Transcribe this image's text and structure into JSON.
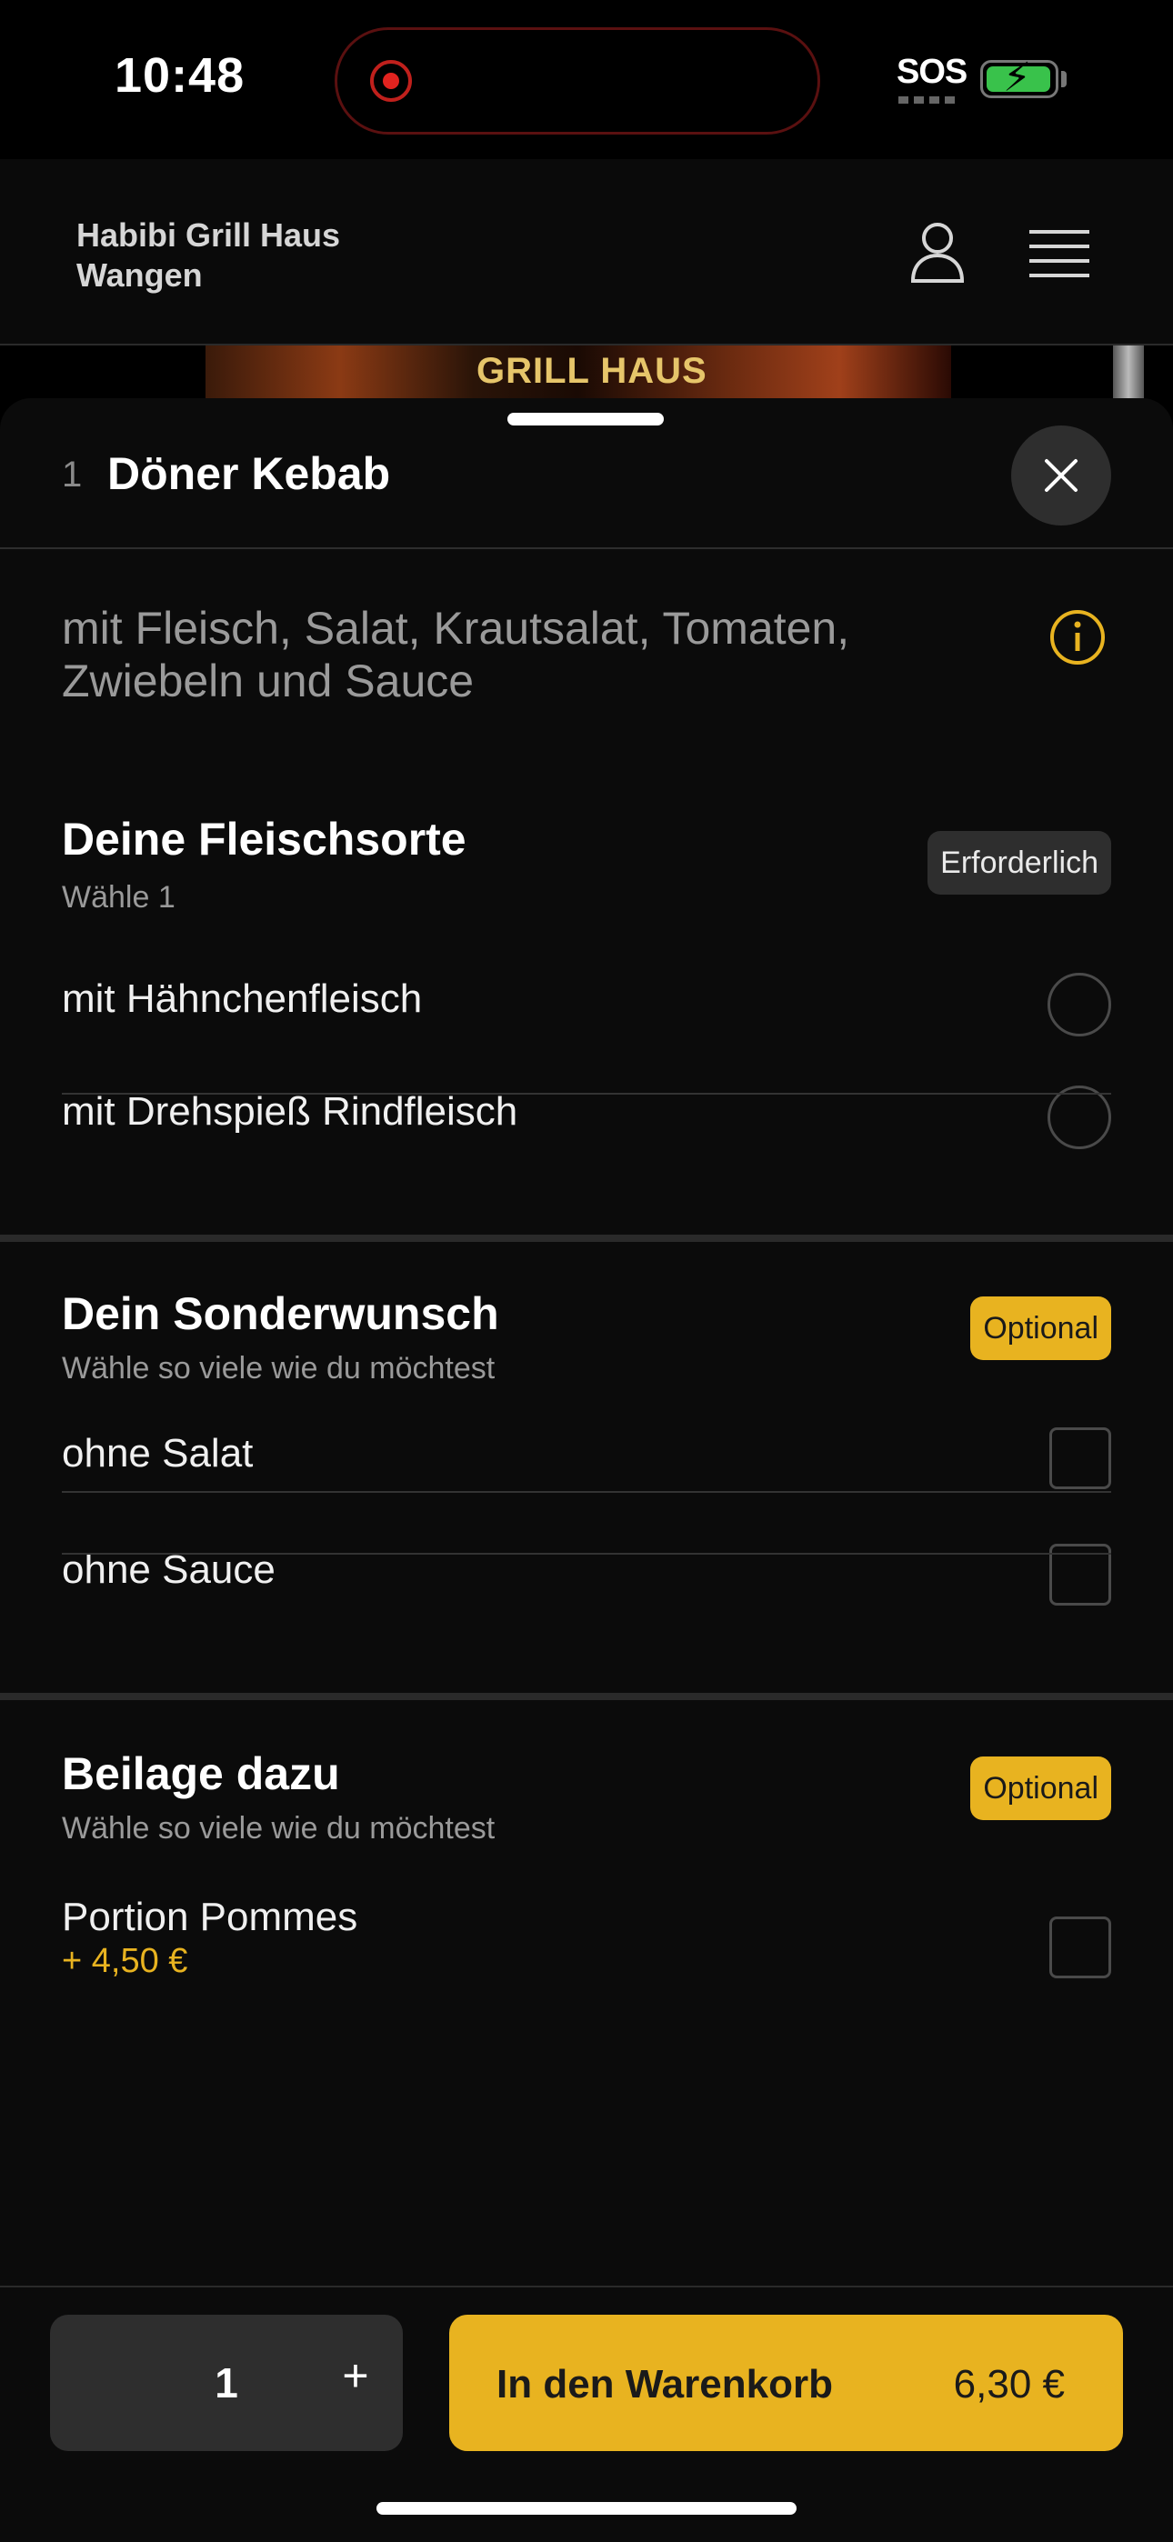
{
  "status_bar": {
    "time": "10:48",
    "sos": "SOS"
  },
  "header": {
    "store_name_line1": "Habibi Grill Haus",
    "store_name_line2": "Wangen"
  },
  "banner": {
    "text": "GRILL HAUS"
  },
  "product": {
    "quantity_prefix": "1",
    "title": "Döner Kebab",
    "description": "mit Fleisch, Salat, Krautsalat, Tomaten, Zwiebeln und Sauce"
  },
  "sections": {
    "meat": {
      "title": "Deine Fleischsorte",
      "subtitle": "Wähle 1",
      "badge": "Erforderlich",
      "options": [
        {
          "label": "mit Hähnchenfleisch"
        },
        {
          "label": "mit Drehspieß Rindfleisch"
        }
      ]
    },
    "special": {
      "title": "Dein Sonderwunsch",
      "subtitle": "Wähle so viele wie du möchtest",
      "badge": "Optional",
      "options": [
        {
          "label": "ohne Salat"
        },
        {
          "label": "ohne Sauce"
        }
      ]
    },
    "side": {
      "title": "Beilage dazu",
      "subtitle": "Wähle so viele wie du möchtest",
      "badge": "Optional",
      "options": [
        {
          "label": "Portion Pommes",
          "price": "+ 4,50 €"
        }
      ]
    }
  },
  "footer": {
    "quantity": "1",
    "plus": "+",
    "cart_label": "In den Warenkorb",
    "cart_price": "6,30 €"
  },
  "colors": {
    "accent": "#e8b320",
    "background": "#0b0b0b",
    "surface": "#2e2e2e"
  }
}
